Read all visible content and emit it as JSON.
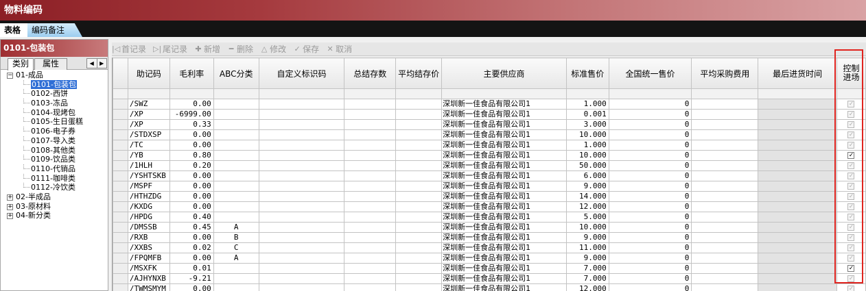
{
  "window": {
    "title": "物料编码"
  },
  "tabs": [
    {
      "label": "表格",
      "active": true
    },
    {
      "label": "编码备注",
      "active": false
    }
  ],
  "left_panel": {
    "header": "0101-包装包",
    "subtabs": [
      "类别",
      "属性"
    ],
    "arrows": [
      "◀",
      "▶"
    ],
    "tree": [
      {
        "label": "01-成品",
        "toggle": "−",
        "children": [
          "0101-包装包",
          "0102-西饼",
          "0103-冻品",
          "0104-现烤包",
          "0105-生日蛋糕",
          "0106-电子券",
          "0107-导入类",
          "0108-其他类",
          "0109-饮品类",
          "0110-代销品",
          "0111-咖啡类",
          "0112-冷饮类"
        ]
      },
      {
        "label": "02-半成品",
        "toggle": "+"
      },
      {
        "label": "03-原材料",
        "toggle": "+"
      },
      {
        "label": "04-新分类",
        "toggle": "+"
      }
    ],
    "selected": "0101-包装包"
  },
  "toolbar": [
    {
      "icon": "|◁",
      "icon_name": "first-record-icon",
      "label": "首记录"
    },
    {
      "icon": "▷|",
      "icon_name": "last-record-icon",
      "label": "尾记录"
    },
    {
      "icon": "✚",
      "icon_name": "add-icon",
      "label": "新增"
    },
    {
      "icon": "━",
      "icon_name": "delete-icon",
      "label": "删除"
    },
    {
      "icon": "△",
      "icon_name": "edit-icon",
      "label": "修改"
    },
    {
      "icon": "✓",
      "icon_name": "save-icon",
      "label": "保存"
    },
    {
      "icon": "✕",
      "icon_name": "cancel-icon",
      "label": "取消"
    }
  ],
  "grid": {
    "columns": [
      "助记码",
      "毛利率",
      "ABC分类",
      "自定义标识码",
      "总结存数",
      "平均结存价",
      "主要供应商",
      "标准售价",
      "全国统一售价",
      "平均采购费用",
      "最后进货时间",
      "控制进场"
    ],
    "rows": [
      [
        "/SWZ",
        "0.00",
        "",
        "",
        "",
        "",
        "深圳新一佳食品有限公司1",
        "1.000",
        "0",
        "",
        "",
        false
      ],
      [
        "/XP",
        "-6999.00",
        "",
        "",
        "",
        "",
        "深圳新一佳食品有限公司1",
        "0.001",
        "0",
        "",
        "",
        false
      ],
      [
        "/XP",
        "0.33",
        "",
        "",
        "",
        "",
        "深圳新一佳食品有限公司1",
        "3.000",
        "0",
        "",
        "",
        false
      ],
      [
        "/STDXSP",
        "0.00",
        "",
        "",
        "",
        "",
        "深圳新一佳食品有限公司1",
        "10.000",
        "0",
        "",
        "",
        false
      ],
      [
        "/TC",
        "0.00",
        "",
        "",
        "",
        "",
        "深圳新一佳食品有限公司1",
        "1.000",
        "0",
        "",
        "",
        false
      ],
      [
        "/YB",
        "0.80",
        "",
        "",
        "",
        "",
        "深圳新一佳食品有限公司1",
        "10.000",
        "0",
        "",
        "",
        true
      ],
      [
        "/1HLH",
        "0.20",
        "",
        "",
        "",
        "",
        "深圳新一佳食品有限公司1",
        "50.000",
        "0",
        "",
        "",
        false
      ],
      [
        "/YSHTSKB",
        "0.00",
        "",
        "",
        "",
        "",
        "深圳新一佳食品有限公司1",
        "6.000",
        "0",
        "",
        "",
        false
      ],
      [
        "/MSPF",
        "0.00",
        "",
        "",
        "",
        "",
        "深圳新一佳食品有限公司1",
        "9.000",
        "0",
        "",
        "",
        false
      ],
      [
        "/HTHZDG",
        "0.00",
        "",
        "",
        "",
        "",
        "深圳新一佳食品有限公司1",
        "14.000",
        "0",
        "",
        "",
        false
      ],
      [
        "/KXDG",
        "0.00",
        "",
        "",
        "",
        "",
        "深圳新一佳食品有限公司1",
        "12.000",
        "0",
        "",
        "",
        false
      ],
      [
        "/HPDG",
        "0.40",
        "",
        "",
        "",
        "",
        "深圳新一佳食品有限公司1",
        "5.000",
        "0",
        "",
        "",
        false
      ],
      [
        "/DMSSB",
        "0.45",
        "A",
        "",
        "",
        "",
        "深圳新一佳食品有限公司1",
        "10.000",
        "0",
        "",
        "",
        false
      ],
      [
        "/RXB",
        "0.00",
        "B",
        "",
        "",
        "",
        "深圳新一佳食品有限公司1",
        "9.000",
        "0",
        "",
        "",
        false
      ],
      [
        "/XXBS",
        "0.02",
        "C",
        "",
        "",
        "",
        "深圳新一佳食品有限公司1",
        "11.000",
        "0",
        "",
        "",
        false
      ],
      [
        "/FPQMFB",
        "0.00",
        "A",
        "",
        "",
        "",
        "深圳新一佳食品有限公司1",
        "9.000",
        "0",
        "",
        "",
        false
      ],
      [
        "/MSXFK",
        "0.01",
        "",
        "",
        "",
        "",
        "深圳新一佳食品有限公司1",
        "7.000",
        "0",
        "",
        "",
        true
      ],
      [
        "/AJHYNXB",
        "-9.21",
        "",
        "",
        "",
        "",
        "深圳新一佳食品有限公司1",
        "7.000",
        "0",
        "",
        "",
        false
      ],
      [
        "/TWMSMYM",
        "0.00",
        "",
        "",
        "",
        "",
        "深圳新一佳食品有限公司1",
        "12.000",
        "0",
        "",
        "",
        false
      ]
    ]
  }
}
